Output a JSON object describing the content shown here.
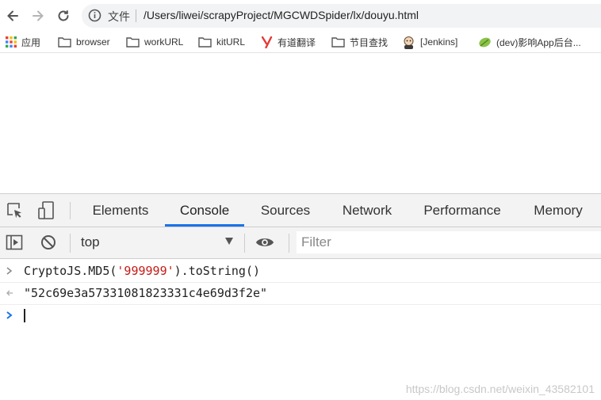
{
  "address_bar": {
    "scheme_label": "文件",
    "url": "/Users/liwei/scrapyProject/MGCWDSpider/lx/douyu.html"
  },
  "bookmarks": [
    {
      "label": "应用",
      "icon": "apps-grid-icon"
    },
    {
      "label": "browser",
      "icon": "folder-icon"
    },
    {
      "label": "workURL",
      "icon": "folder-icon"
    },
    {
      "label": "kitURL",
      "icon": "folder-icon"
    },
    {
      "label": "有道翻译",
      "icon": "youdao-icon"
    },
    {
      "label": "节目查找",
      "icon": "folder-icon"
    },
    {
      "label": "[Jenkins]",
      "icon": "jenkins-icon"
    },
    {
      "label": "(dev)影响App后台...",
      "icon": "leaf-icon"
    }
  ],
  "devtools": {
    "tabs": [
      "Elements",
      "Console",
      "Sources",
      "Network",
      "Performance",
      "Memory"
    ],
    "active_tab": "Console",
    "context": "top",
    "filter_placeholder": "Filter",
    "console": {
      "input_prefix": "CryptoJS.MD5(",
      "input_string": "'999999'",
      "input_suffix": ").toString()",
      "output": "\"52c69e3a57331081823331c4e69d3f2e\""
    }
  },
  "colors": {
    "accent": "#1a73e8",
    "string": "#c41a16"
  },
  "watermark": "https://blog.csdn.net/weixin_43582101"
}
